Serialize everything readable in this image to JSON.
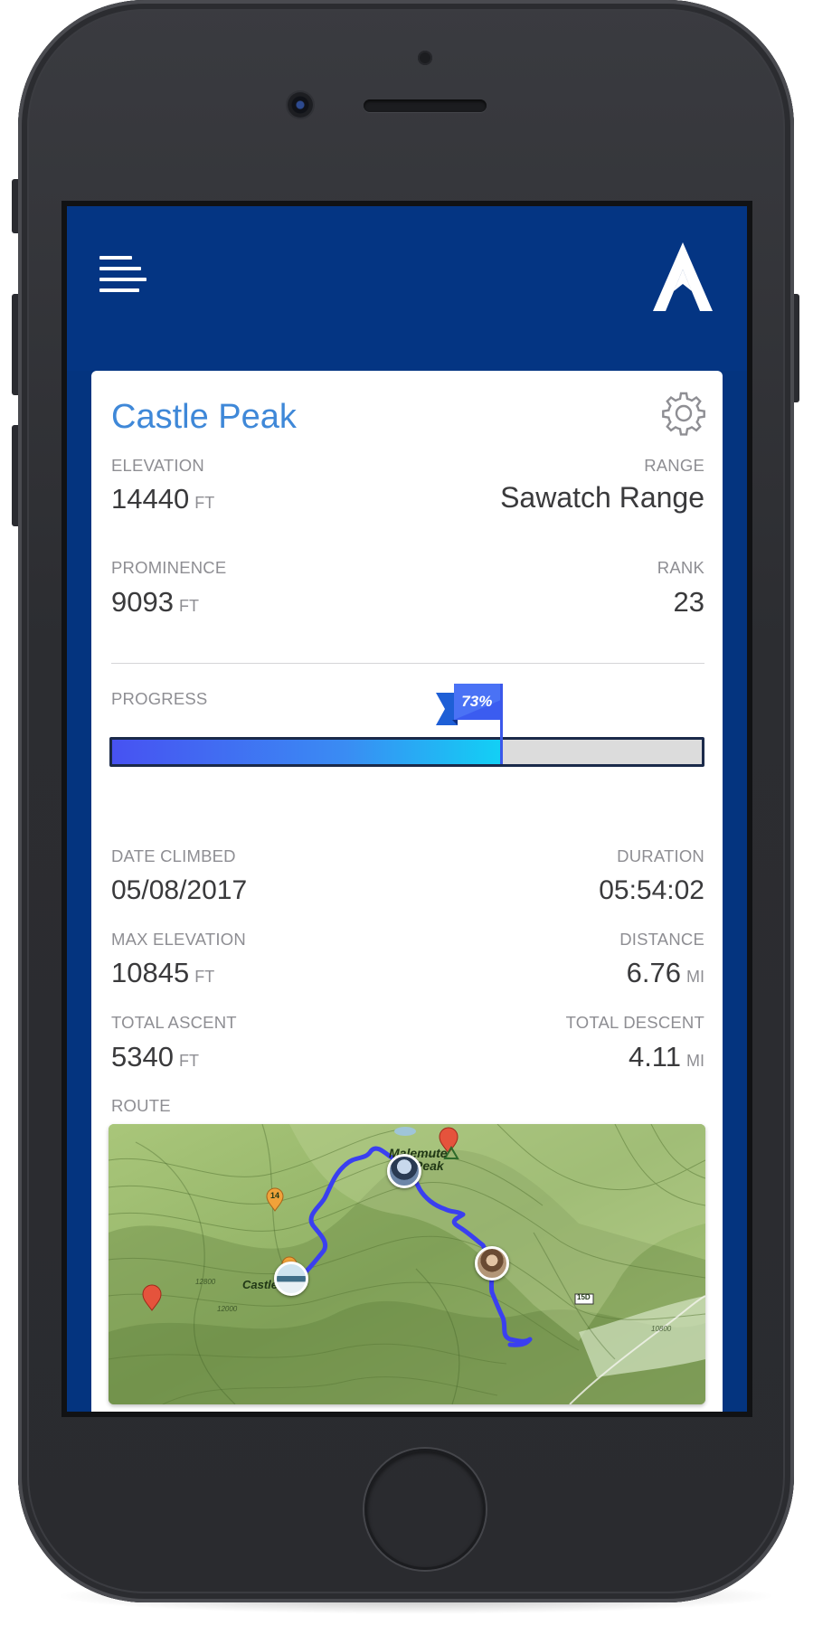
{
  "app": {
    "title": "Castle Peak",
    "menu_icon": "hamburger-menu-icon",
    "logo_icon": "mountain-logo-icon",
    "settings_icon": "gear-icon"
  },
  "stats_top": {
    "elevation": {
      "label": "ELEVATION",
      "value": "14440",
      "unit": "FT"
    },
    "range": {
      "label": "RANGE",
      "value": "Sawatch Range"
    },
    "prominence": {
      "label": "PROMINENCE",
      "value": "9093",
      "unit": "FT"
    },
    "rank": {
      "label": "RANK",
      "value": "23"
    }
  },
  "progress": {
    "label": "PROGRESS",
    "percent_text": "73%",
    "fraction": 0.66
  },
  "stats_climb": {
    "date_climbed": {
      "label": "DATE CLIMBED",
      "value": "05/08/2017"
    },
    "duration": {
      "label": "DURATION",
      "value": "05:54:02"
    },
    "max_elevation": {
      "label": "MAX ELEVATION",
      "value": "10845",
      "unit": "FT"
    },
    "distance": {
      "label": "DISTANCE",
      "value": "6.76",
      "unit": "MI"
    },
    "total_ascent": {
      "label": "TOTAL ASCENT",
      "value": "5340",
      "unit": "FT"
    },
    "total_descent": {
      "label": "TOTAL DESCENT",
      "value": "4.11",
      "unit": "MI"
    }
  },
  "route": {
    "label": "ROUTE",
    "map_labels": {
      "malemute": "Malemute",
      "peak": "Peak",
      "castle_peak": "Castle Pea",
      "route_sign": "15D",
      "marker_number": "14",
      "contour_1": "12800",
      "contour_2": "12000",
      "contour_3": "10800"
    }
  },
  "colors": {
    "header_bg": "#043583",
    "title_blue": "#3f88d8",
    "route_line": "#3a3ff0",
    "progress_start": "#4752f2",
    "progress_end": "#12d0f5"
  }
}
